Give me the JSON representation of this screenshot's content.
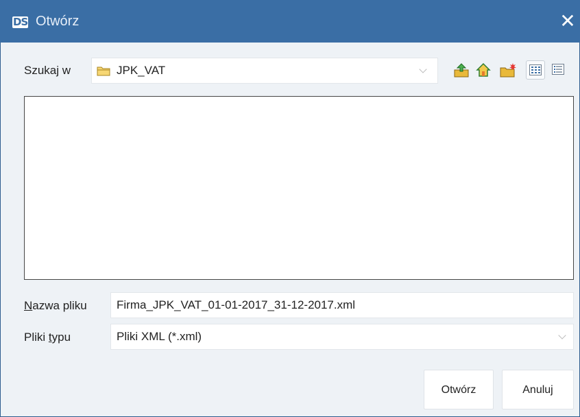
{
  "window": {
    "title": "Otwórz",
    "logo_text": "DS",
    "close_glyph": "✕"
  },
  "look_in": {
    "label": "Szukaj w",
    "value": "JPK_VAT"
  },
  "toolbar": {
    "buttons": [
      {
        "name": "up-one-level-icon"
      },
      {
        "name": "home-icon"
      },
      {
        "name": "new-folder-icon"
      },
      {
        "name": "list-view-icon"
      },
      {
        "name": "details-view-icon"
      }
    ]
  },
  "file_name": {
    "label_underlined": "N",
    "label_rest": "azwa pliku",
    "value": "Firma_JPK_VAT_01-01-2017_31-12-2017.xml"
  },
  "file_type": {
    "label_start": "Pliki ",
    "label_underlined": "t",
    "label_rest": "ypu",
    "value": "Pliki XML (*.xml)"
  },
  "buttons": {
    "open": "Otwórz",
    "cancel": "Anuluj"
  },
  "colors": {
    "titlebar": "#3a6ea5",
    "background": "#eef2f6",
    "folder": "#f2c94c"
  }
}
